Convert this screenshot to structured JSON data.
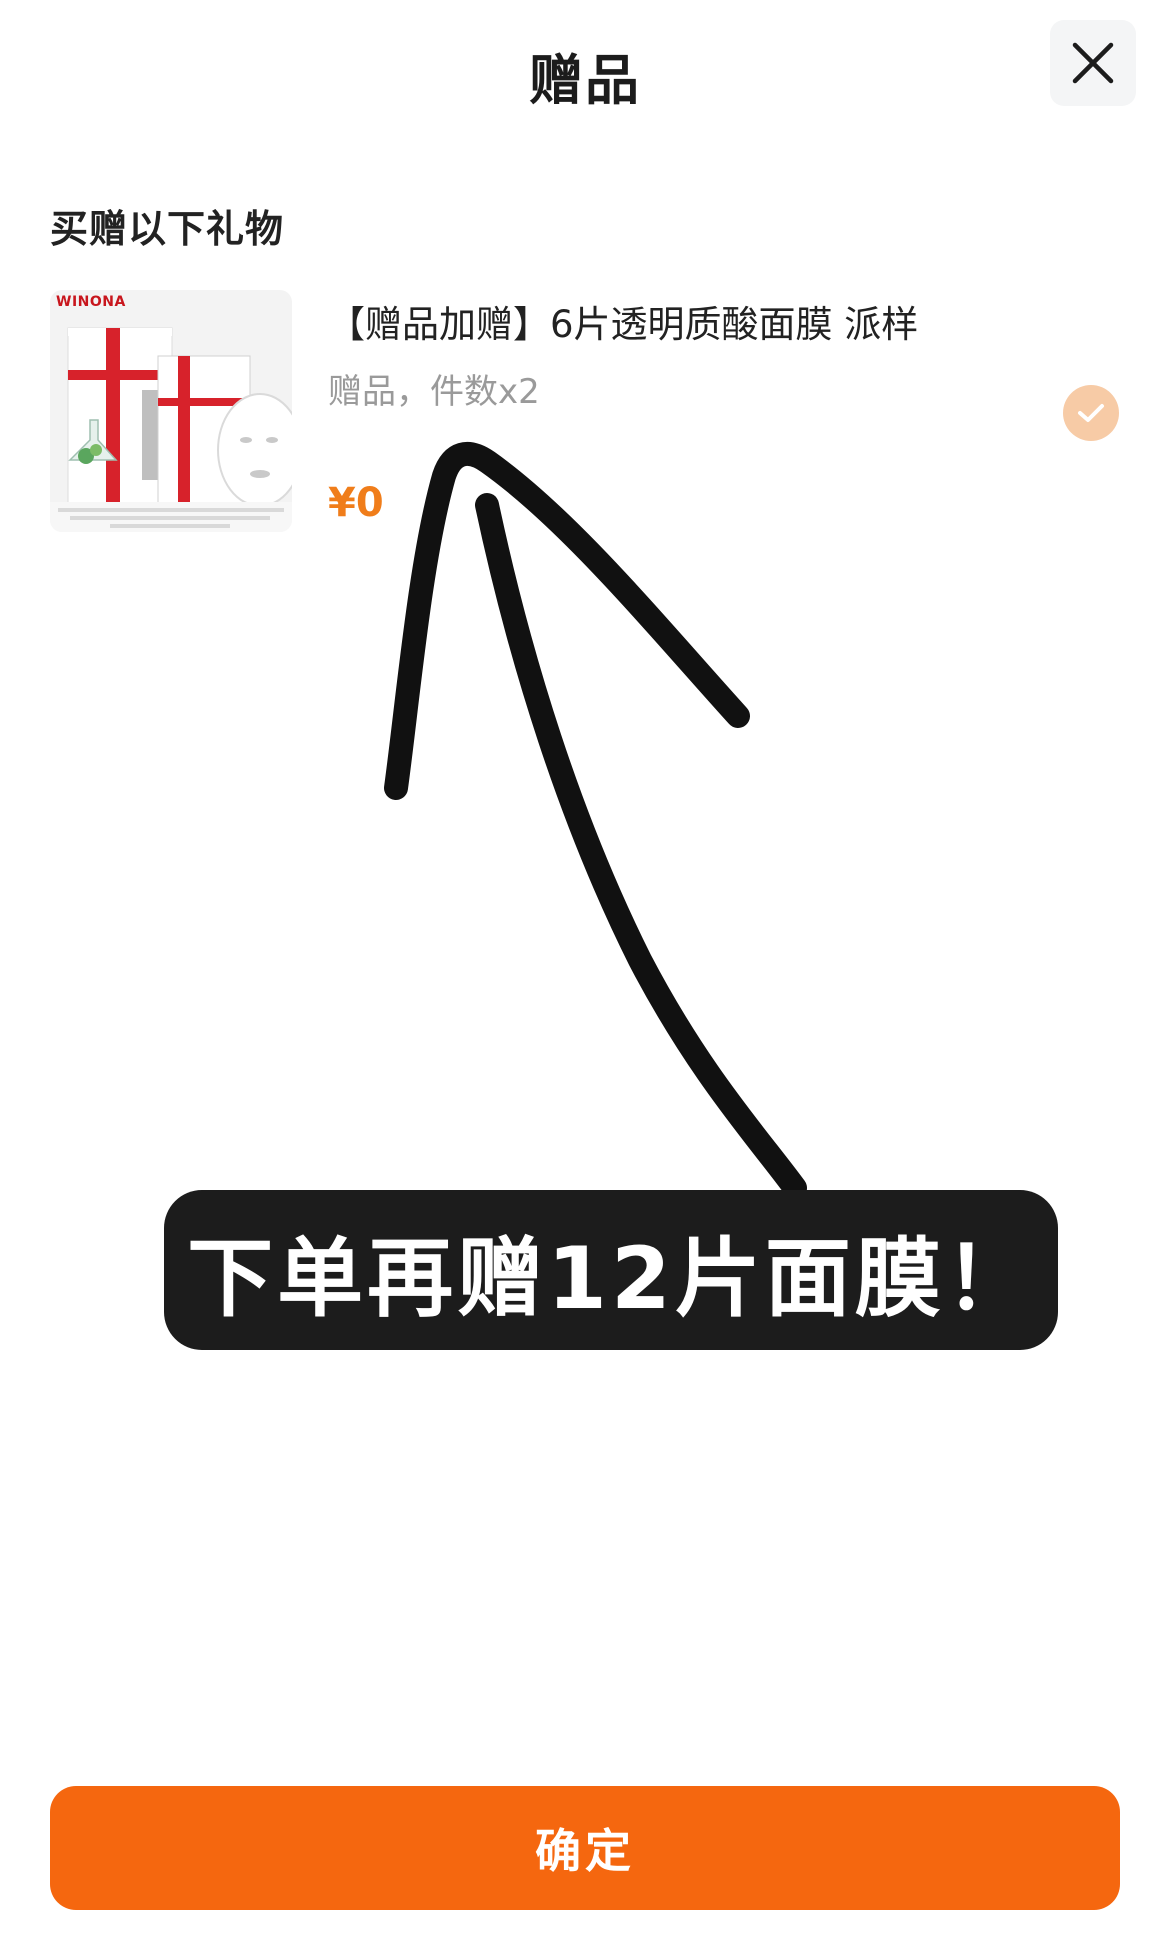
{
  "header": {
    "title": "赠品",
    "close_icon": "close-icon"
  },
  "section": {
    "title": "买赠以下礼物"
  },
  "gift_item": {
    "image_brand": "WINONA",
    "name": "【赠品加赠】6片透明质酸面膜 派样",
    "meta": "赠品，件数x2",
    "price": "¥0",
    "selected": true,
    "check_icon": "check-icon"
  },
  "overlay": {
    "text": "下单再赠12片面膜！",
    "arrow_icon": "hand-drawn-arrow-icon"
  },
  "footer": {
    "confirm_label": "确定"
  },
  "colors": {
    "accent": "#f5670f",
    "price": "#f07d1a",
    "check_selected": "#f7cba6",
    "overlay_bg": "#1c1c1c"
  }
}
